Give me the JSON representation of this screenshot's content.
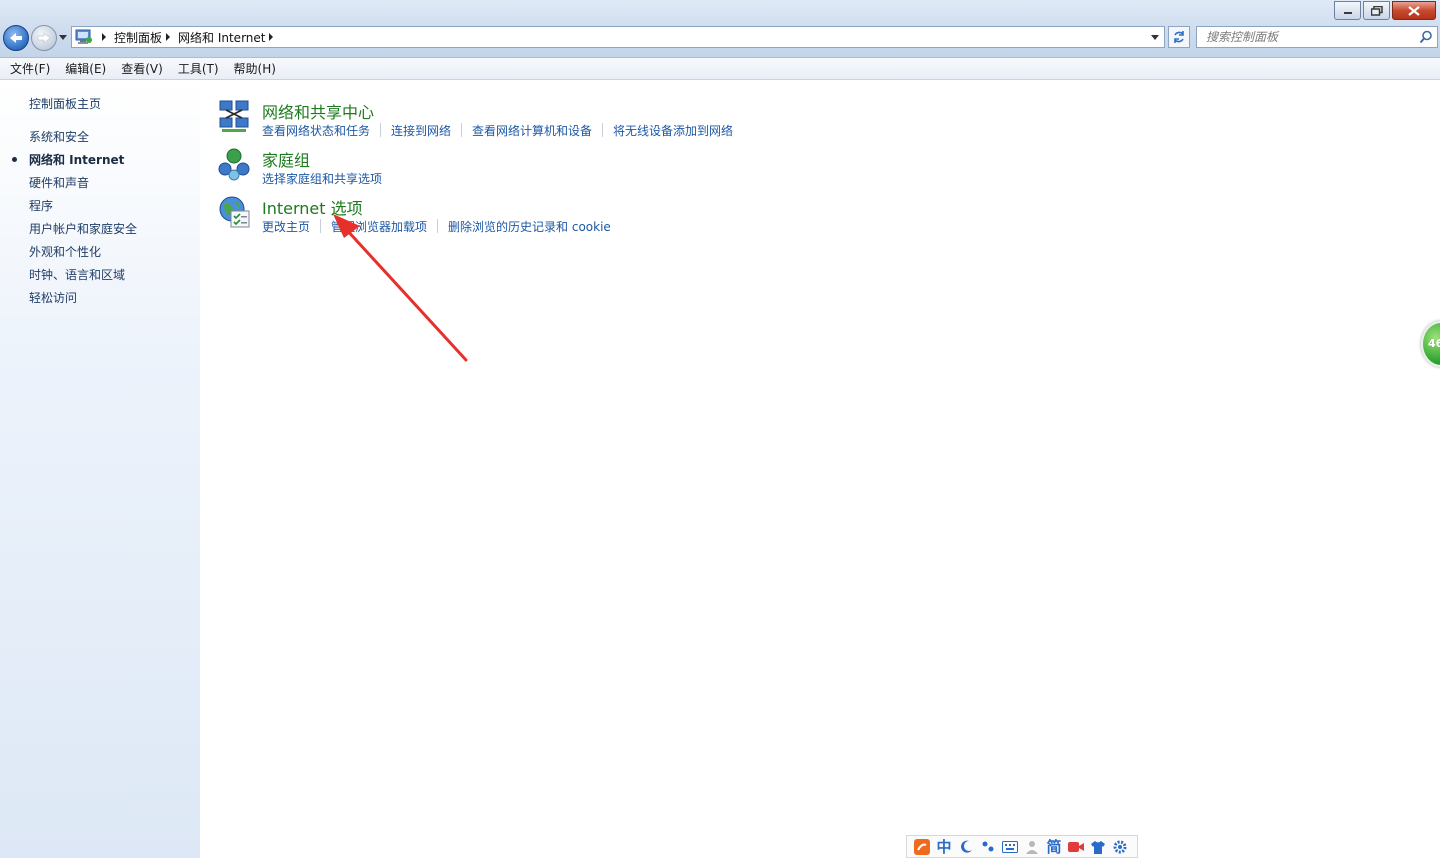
{
  "window": {
    "controls": [
      "minimize",
      "restore",
      "close"
    ]
  },
  "address": {
    "breadcrumbs": [
      "控制面板",
      "网络和 Internet"
    ],
    "search_placeholder": "搜索控制面板"
  },
  "menu": [
    "文件(F)",
    "编辑(E)",
    "查看(V)",
    "工具(T)",
    "帮助(H)"
  ],
  "sidebar": {
    "home": "控制面板主页",
    "items": [
      {
        "label": "系统和安全",
        "active": false
      },
      {
        "label": "网络和 Internet",
        "active": true
      },
      {
        "label": "硬件和声音",
        "active": false
      },
      {
        "label": "程序",
        "active": false
      },
      {
        "label": "用户帐户和家庭安全",
        "active": false
      },
      {
        "label": "外观和个性化",
        "active": false
      },
      {
        "label": "时钟、语言和区域",
        "active": false
      },
      {
        "label": "轻松访问",
        "active": false
      }
    ]
  },
  "categories": [
    {
      "title": "网络和共享中心",
      "icon": "network-sharing-icon",
      "links": [
        "查看网络状态和任务",
        "连接到网络",
        "查看网络计算机和设备",
        "将无线设备添加到网络"
      ]
    },
    {
      "title": "家庭组",
      "icon": "homegroup-icon",
      "links": [
        "选择家庭组和共享选项"
      ]
    },
    {
      "title": "Internet 选项",
      "icon": "internet-options-icon",
      "links": [
        "更改主页",
        "管理浏览器加载项",
        "删除浏览的历史记录和 cookie"
      ]
    }
  ],
  "floating_badge": "46",
  "ime_toolbar": {
    "mode": "中",
    "script": "简"
  },
  "colors": {
    "category_title": "#1e7a1e",
    "link": "#1d58a5",
    "annotation_arrow": "#e8302a"
  }
}
